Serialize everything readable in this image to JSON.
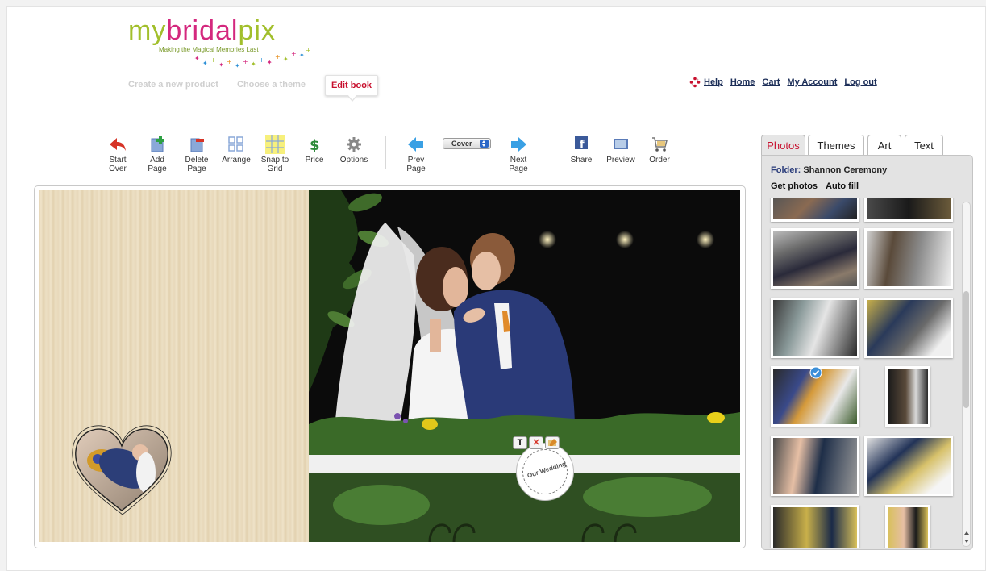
{
  "brand": {
    "logo_text": "mybridalpix",
    "tagline": "Making the Magical Memories Last",
    "colors": {
      "my": "#a2bf2c",
      "bridal": "#d4287e",
      "pix": "#a2bf2c"
    }
  },
  "steps": {
    "create": "Create a new product",
    "theme": "Choose a theme",
    "edit": "Edit book"
  },
  "top_links": {
    "help": "Help",
    "home": "Home",
    "cart": "Cart",
    "account": "My Account",
    "logout": "Log out"
  },
  "toolbar": {
    "start_over": [
      "Start",
      "Over"
    ],
    "add_page": [
      "Add",
      "Page"
    ],
    "delete_page": [
      "Delete",
      "Page"
    ],
    "arrange": "Arrange",
    "snap_to_grid": [
      "Snap to",
      "Grid"
    ],
    "price": "Price",
    "options": "Options",
    "prev_page": [
      "Prev",
      "Page"
    ],
    "page_select": "Cover",
    "next_page": [
      "Next",
      "Page"
    ],
    "share": "Share",
    "preview": "Preview",
    "order": "Order"
  },
  "canvas": {
    "stamp_text": "Our Wedding",
    "stamp_tools": {
      "text": "T",
      "delete": "✕"
    }
  },
  "panel": {
    "tabs": [
      "Photos",
      "Themes",
      "Art",
      "Text"
    ],
    "active_tab": "Photos",
    "folder_label": "Folder:",
    "folder_name": "Shannon Ceremony",
    "get_photos": "Get photos",
    "auto_fill": "Auto fill"
  },
  "colors": {
    "accent_red": "#c8102e",
    "link_navy": "#1c2e58"
  }
}
